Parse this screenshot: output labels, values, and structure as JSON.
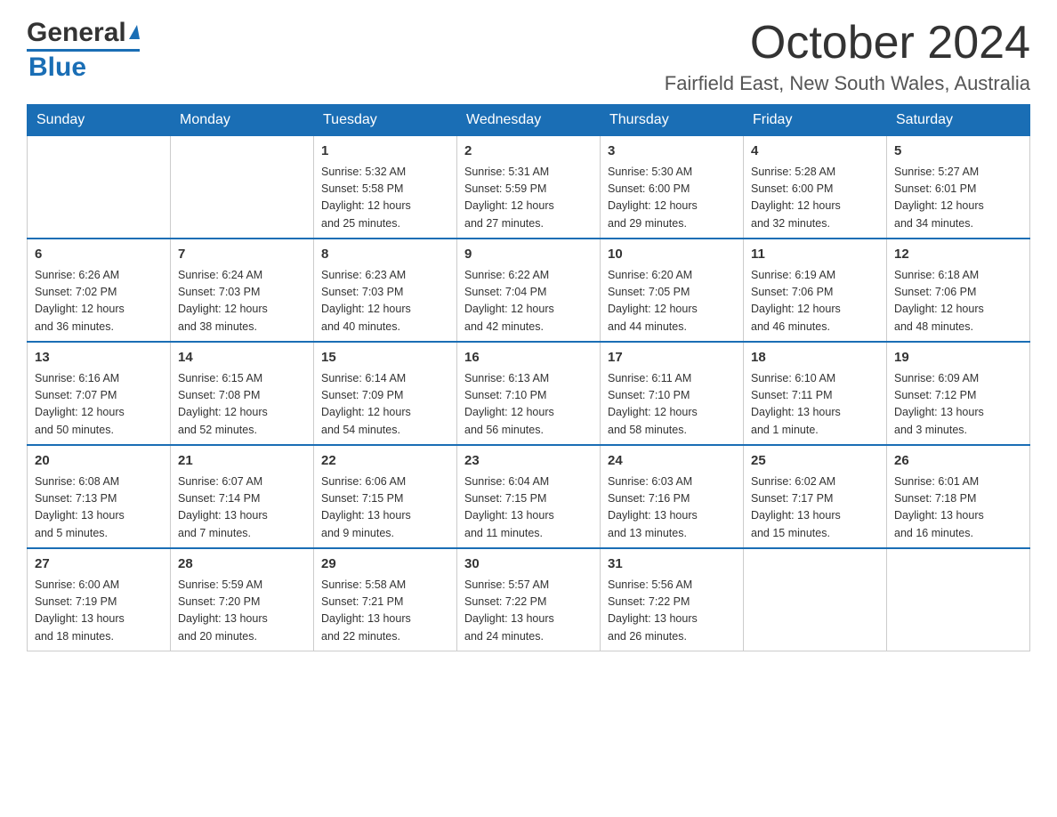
{
  "logo": {
    "text_general": "General",
    "text_blue": "Blue"
  },
  "header": {
    "month_title": "October 2024",
    "location": "Fairfield East, New South Wales, Australia"
  },
  "columns": [
    "Sunday",
    "Monday",
    "Tuesday",
    "Wednesday",
    "Thursday",
    "Friday",
    "Saturday"
  ],
  "weeks": [
    [
      {
        "day": "",
        "info": ""
      },
      {
        "day": "",
        "info": ""
      },
      {
        "day": "1",
        "info": "Sunrise: 5:32 AM\nSunset: 5:58 PM\nDaylight: 12 hours\nand 25 minutes."
      },
      {
        "day": "2",
        "info": "Sunrise: 5:31 AM\nSunset: 5:59 PM\nDaylight: 12 hours\nand 27 minutes."
      },
      {
        "day": "3",
        "info": "Sunrise: 5:30 AM\nSunset: 6:00 PM\nDaylight: 12 hours\nand 29 minutes."
      },
      {
        "day": "4",
        "info": "Sunrise: 5:28 AM\nSunset: 6:00 PM\nDaylight: 12 hours\nand 32 minutes."
      },
      {
        "day": "5",
        "info": "Sunrise: 5:27 AM\nSunset: 6:01 PM\nDaylight: 12 hours\nand 34 minutes."
      }
    ],
    [
      {
        "day": "6",
        "info": "Sunrise: 6:26 AM\nSunset: 7:02 PM\nDaylight: 12 hours\nand 36 minutes."
      },
      {
        "day": "7",
        "info": "Sunrise: 6:24 AM\nSunset: 7:03 PM\nDaylight: 12 hours\nand 38 minutes."
      },
      {
        "day": "8",
        "info": "Sunrise: 6:23 AM\nSunset: 7:03 PM\nDaylight: 12 hours\nand 40 minutes."
      },
      {
        "day": "9",
        "info": "Sunrise: 6:22 AM\nSunset: 7:04 PM\nDaylight: 12 hours\nand 42 minutes."
      },
      {
        "day": "10",
        "info": "Sunrise: 6:20 AM\nSunset: 7:05 PM\nDaylight: 12 hours\nand 44 minutes."
      },
      {
        "day": "11",
        "info": "Sunrise: 6:19 AM\nSunset: 7:06 PM\nDaylight: 12 hours\nand 46 minutes."
      },
      {
        "day": "12",
        "info": "Sunrise: 6:18 AM\nSunset: 7:06 PM\nDaylight: 12 hours\nand 48 minutes."
      }
    ],
    [
      {
        "day": "13",
        "info": "Sunrise: 6:16 AM\nSunset: 7:07 PM\nDaylight: 12 hours\nand 50 minutes."
      },
      {
        "day": "14",
        "info": "Sunrise: 6:15 AM\nSunset: 7:08 PM\nDaylight: 12 hours\nand 52 minutes."
      },
      {
        "day": "15",
        "info": "Sunrise: 6:14 AM\nSunset: 7:09 PM\nDaylight: 12 hours\nand 54 minutes."
      },
      {
        "day": "16",
        "info": "Sunrise: 6:13 AM\nSunset: 7:10 PM\nDaylight: 12 hours\nand 56 minutes."
      },
      {
        "day": "17",
        "info": "Sunrise: 6:11 AM\nSunset: 7:10 PM\nDaylight: 12 hours\nand 58 minutes."
      },
      {
        "day": "18",
        "info": "Sunrise: 6:10 AM\nSunset: 7:11 PM\nDaylight: 13 hours\nand 1 minute."
      },
      {
        "day": "19",
        "info": "Sunrise: 6:09 AM\nSunset: 7:12 PM\nDaylight: 13 hours\nand 3 minutes."
      }
    ],
    [
      {
        "day": "20",
        "info": "Sunrise: 6:08 AM\nSunset: 7:13 PM\nDaylight: 13 hours\nand 5 minutes."
      },
      {
        "day": "21",
        "info": "Sunrise: 6:07 AM\nSunset: 7:14 PM\nDaylight: 13 hours\nand 7 minutes."
      },
      {
        "day": "22",
        "info": "Sunrise: 6:06 AM\nSunset: 7:15 PM\nDaylight: 13 hours\nand 9 minutes."
      },
      {
        "day": "23",
        "info": "Sunrise: 6:04 AM\nSunset: 7:15 PM\nDaylight: 13 hours\nand 11 minutes."
      },
      {
        "day": "24",
        "info": "Sunrise: 6:03 AM\nSunset: 7:16 PM\nDaylight: 13 hours\nand 13 minutes."
      },
      {
        "day": "25",
        "info": "Sunrise: 6:02 AM\nSunset: 7:17 PM\nDaylight: 13 hours\nand 15 minutes."
      },
      {
        "day": "26",
        "info": "Sunrise: 6:01 AM\nSunset: 7:18 PM\nDaylight: 13 hours\nand 16 minutes."
      }
    ],
    [
      {
        "day": "27",
        "info": "Sunrise: 6:00 AM\nSunset: 7:19 PM\nDaylight: 13 hours\nand 18 minutes."
      },
      {
        "day": "28",
        "info": "Sunrise: 5:59 AM\nSunset: 7:20 PM\nDaylight: 13 hours\nand 20 minutes."
      },
      {
        "day": "29",
        "info": "Sunrise: 5:58 AM\nSunset: 7:21 PM\nDaylight: 13 hours\nand 22 minutes."
      },
      {
        "day": "30",
        "info": "Sunrise: 5:57 AM\nSunset: 7:22 PM\nDaylight: 13 hours\nand 24 minutes."
      },
      {
        "day": "31",
        "info": "Sunrise: 5:56 AM\nSunset: 7:22 PM\nDaylight: 13 hours\nand 26 minutes."
      },
      {
        "day": "",
        "info": ""
      },
      {
        "day": "",
        "info": ""
      }
    ]
  ]
}
